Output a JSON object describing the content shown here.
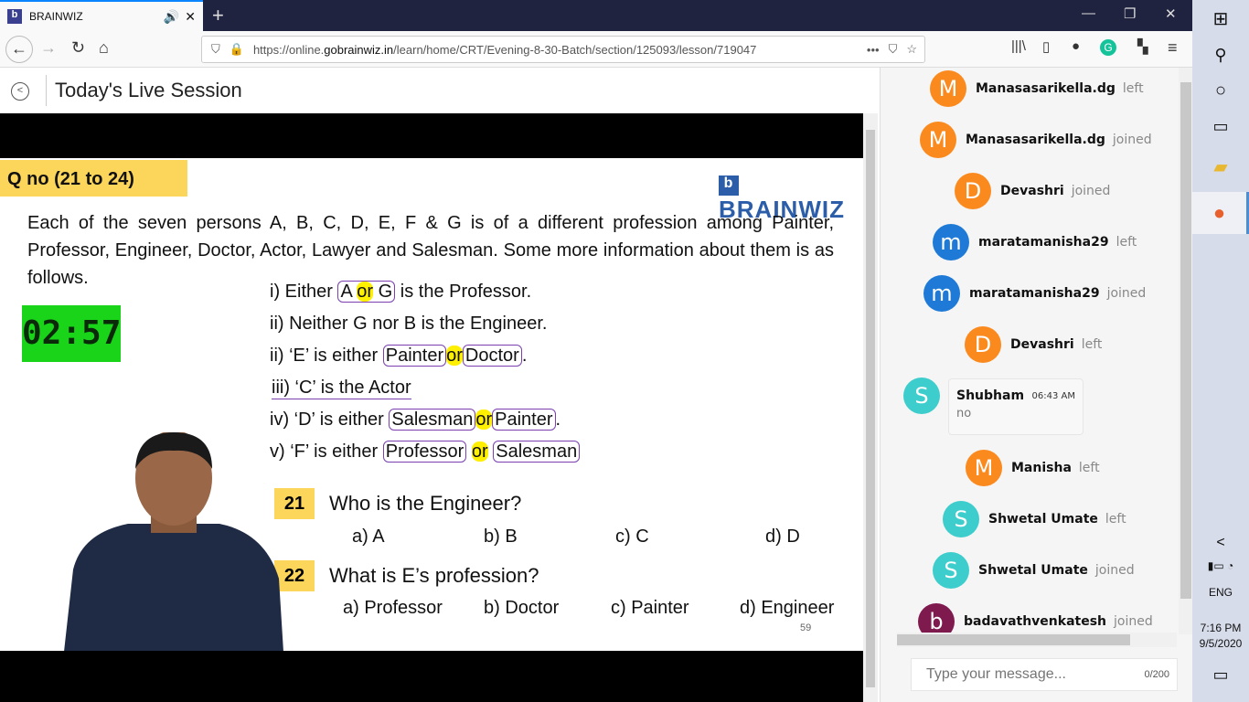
{
  "browser": {
    "tab_title": "BRAINWIZ",
    "url_prefix": "https://online.",
    "url_domain": "gobrainwiz.in",
    "url_path": "/learn/home/CRT/Evening-8-30-Batch/section/125093/lesson/719047"
  },
  "page": {
    "title": "Today's Live Session"
  },
  "slide": {
    "qno": "Q no (21 to 24)",
    "logo": "BRAINWIZ",
    "logo_mark": "b",
    "paragraph": "Each of the seven persons A, B, C, D, E, F & G is of a different profession among Painter, Professor, Engineer, Doctor, Actor, Lawyer and Salesman. Some more information about them is as follows.",
    "timer": "02:57",
    "conditions": [
      {
        "pre": "i)  Either ",
        "a": "A",
        "or": "or",
        "b": "G",
        "post": " is the Professor."
      },
      {
        "text": "ii)  Neither G nor B is the Engineer."
      },
      {
        "pre": "ii)  ‘E’ is either ",
        "a": "Painter",
        "or": "or",
        "b": "Doctor",
        "post": "."
      },
      {
        "text": "iii)  ‘C’ is the Actor"
      },
      {
        "pre": "iv)  ‘D’ is either ",
        "a": "Salesman",
        "or": "or",
        "b": "Painter",
        "post": "."
      },
      {
        "pre": "v)   ‘F’ is either ",
        "a": "Professor",
        "or": "or",
        "b": "Salesman",
        "post": ""
      }
    ],
    "questions": [
      {
        "num": "21",
        "text": "Who is the Engineer?",
        "options": [
          "a) A",
          "b) B",
          "c) C",
          "d) D"
        ]
      },
      {
        "num": "22",
        "text": "What is E’s profession?",
        "options": [
          "a) Professor",
          "b) Doctor",
          "c) Painter",
          "d) Engineer"
        ]
      }
    ],
    "page_number": "59"
  },
  "chat": {
    "events": [
      {
        "initial": "M",
        "name": "Manasasarikella.dg",
        "status": "left",
        "color": "#fb8a1e"
      },
      {
        "initial": "M",
        "name": "Manasasarikella.dg",
        "status": "joined",
        "color": "#fb8a1e"
      },
      {
        "initial": "D",
        "name": "Devashri",
        "status": "joined",
        "color": "#fb8a1e"
      },
      {
        "initial": "m",
        "name": "maratamanisha29",
        "status": "left",
        "color": "#1e7ad6"
      },
      {
        "initial": "m",
        "name": "maratamanisha29",
        "status": "joined",
        "color": "#1e7ad6"
      },
      {
        "initial": "D",
        "name": "Devashri",
        "status": "left",
        "color": "#fb8a1e"
      },
      {
        "initial": "M",
        "name": "Manisha",
        "status": "left",
        "color": "#fb8a1e"
      },
      {
        "initial": "S",
        "name": "Shwetal Umate",
        "status": "left",
        "color": "#3ccdcc"
      },
      {
        "initial": "S",
        "name": "Shwetal Umate",
        "status": "joined",
        "color": "#3ccdcc"
      },
      {
        "initial": "b",
        "name": "badavathvenkatesh",
        "status": "joined",
        "color": "#7e1a4e"
      }
    ],
    "message": {
      "initial": "S",
      "author": "Shubham",
      "time": "06:43 AM",
      "text": "no",
      "color": "#3ccdcc"
    },
    "input_placeholder": "Type your message...",
    "counter": "0/200"
  },
  "taskbar": {
    "lang": "ENG",
    "time": "7:16 PM",
    "date": "9/5/2020"
  }
}
